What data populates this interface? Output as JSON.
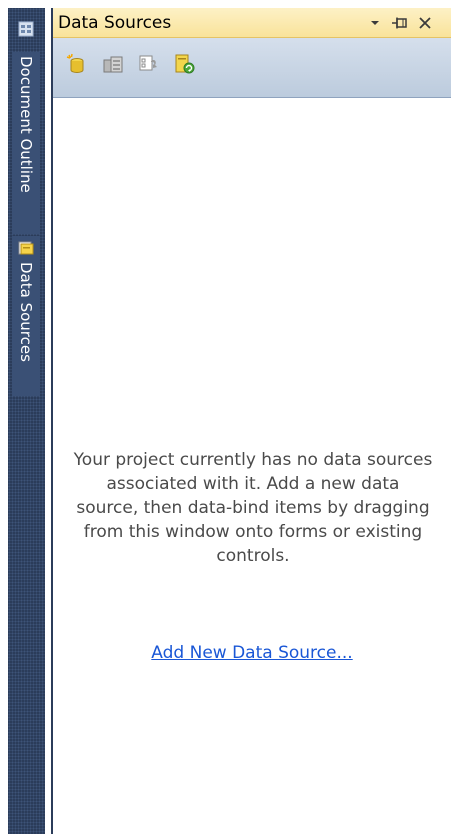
{
  "side_tabs": {
    "document_outline": "Document Outline",
    "data_sources": "Data Sources"
  },
  "panel": {
    "title": "Data Sources",
    "icons": {
      "dropdown": "chevron-down-icon",
      "pin": "pin-icon",
      "close": "close-icon"
    }
  },
  "toolbar": {
    "buttons": [
      {
        "name": "add-new-data-source",
        "icon": "add-data-source-icon"
      },
      {
        "name": "edit-dataset-with-designer",
        "icon": "edit-dataset-icon"
      },
      {
        "name": "configure-dataset",
        "icon": "configure-dataset-icon"
      },
      {
        "name": "refresh",
        "icon": "refresh-icon"
      }
    ]
  },
  "content": {
    "message": "Your project currently has no data sources associated with it. Add a new data source, then data-bind items by dragging from this window onto forms or existing controls.",
    "link": "Add New Data Source..."
  },
  "colors": {
    "strip": "#2b3c5a",
    "titlebar": "#f9e39a",
    "toolbar": "#bccbdd",
    "link": "#1a57d6"
  }
}
